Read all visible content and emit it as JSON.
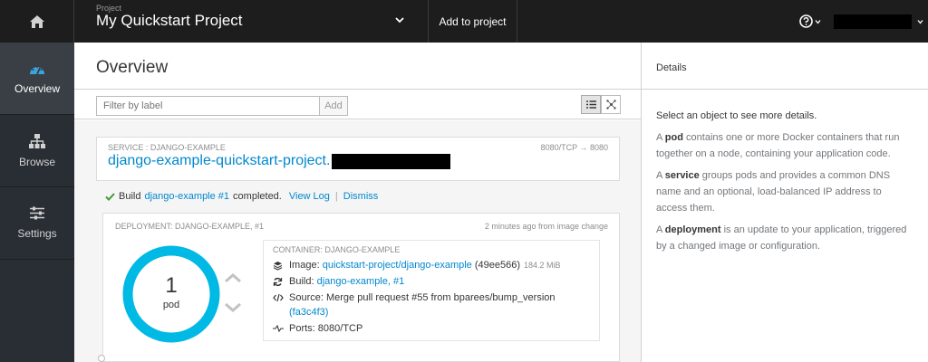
{
  "topbar": {
    "project_caption": "Project",
    "project_name": "My Quickstart Project",
    "add_to_project": "Add to project"
  },
  "leftnav": {
    "items": [
      {
        "label": "Overview",
        "icon": "dashboard-icon",
        "active": true
      },
      {
        "label": "Browse",
        "icon": "sitemap-icon"
      },
      {
        "label": "Settings",
        "icon": "sliders-icon"
      }
    ]
  },
  "main": {
    "title": "Overview",
    "filter_placeholder": "Filter by label",
    "filter_add": "Add",
    "service": {
      "label": "SERVICE : DJANGO-EXAMPLE",
      "ports": "8080/TCP → 8080",
      "name": "django-example-quickstart-project."
    },
    "build": {
      "prefix": "Build",
      "link": "django-example #1",
      "suffix": "completed.",
      "view_log": "View Log",
      "separator": "|",
      "dismiss": "Dismiss"
    },
    "deployment": {
      "label": "DEPLOYMENT: DJANGO-EXAMPLE, #1",
      "time": "2 minutes ago from image change",
      "pod_count": "1",
      "pod_unit": "pod",
      "container": {
        "label": "CONTAINER: DJANGO-EXAMPLE",
        "image_label": "Image:",
        "image_link": "quickstart-project/django-example",
        "image_hash": "(49ee566)",
        "image_size": "184.2 MiB",
        "build_label": "Build:",
        "build_link": "django-example, #1",
        "source_label": "Source:",
        "source_text": "Merge pull request #55 from bparees/bump_version",
        "source_commit": "(fa3c4f3)",
        "ports_label": "Ports:",
        "ports_value": "8080/TCP"
      }
    }
  },
  "details": {
    "title": "Details",
    "intro": "Select an object to see more details.",
    "pod_term": "pod",
    "pod_text_a": "A",
    "pod_text_b": "contains one or more Docker containers that run together on a node, containing your application code.",
    "service_term": "service",
    "service_text_a": "A",
    "service_text_b": "groups pods and provides a common DNS name and an optional, load-balanced IP address to access them.",
    "deployment_term": "deployment",
    "deployment_text_a": "A",
    "deployment_text_b": "is an update to your application, triggered by a changed image or configuration."
  },
  "colors": {
    "accent": "#0088ce",
    "pod_ring": "#00b9e4",
    "success": "#3f9c35"
  }
}
